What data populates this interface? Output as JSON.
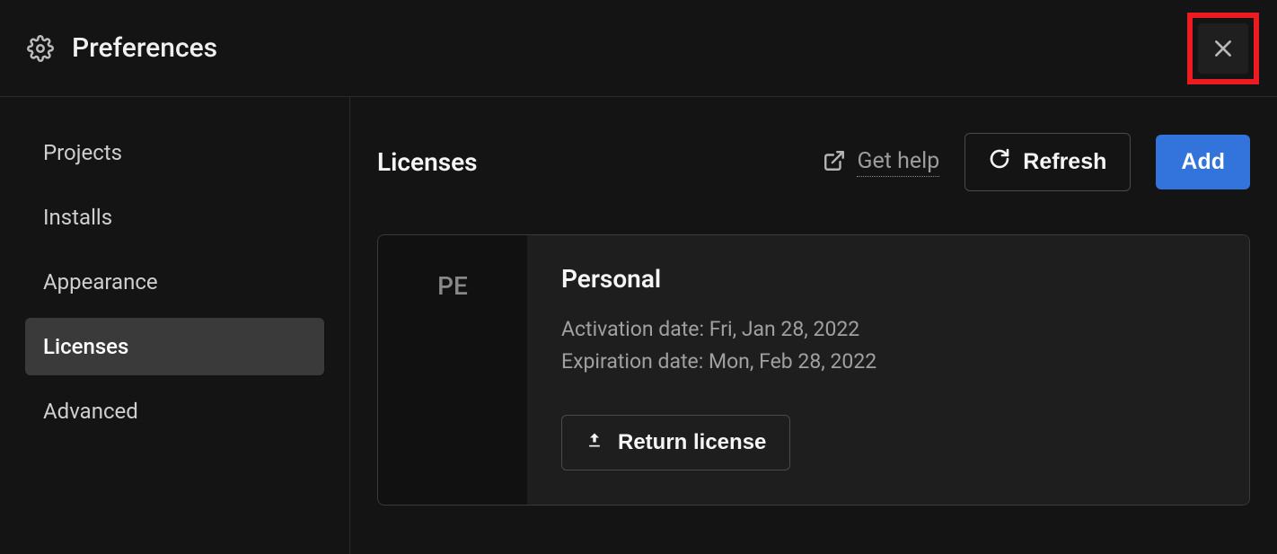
{
  "header": {
    "title": "Preferences"
  },
  "sidebar": {
    "items": [
      {
        "label": "Projects",
        "active": false
      },
      {
        "label": "Installs",
        "active": false
      },
      {
        "label": "Appearance",
        "active": false
      },
      {
        "label": "Licenses",
        "active": true
      },
      {
        "label": "Advanced",
        "active": false
      }
    ]
  },
  "main": {
    "title": "Licenses",
    "get_help_label": "Get help",
    "refresh_label": "Refresh",
    "add_label": "Add",
    "license": {
      "badge": "PE",
      "name": "Personal",
      "activation_label": "Activation date:",
      "activation_date": "Fri, Jan 28, 2022",
      "expiration_label": "Expiration date:",
      "expiration_date": "Mon, Feb 28, 2022",
      "return_label": "Return license"
    }
  }
}
